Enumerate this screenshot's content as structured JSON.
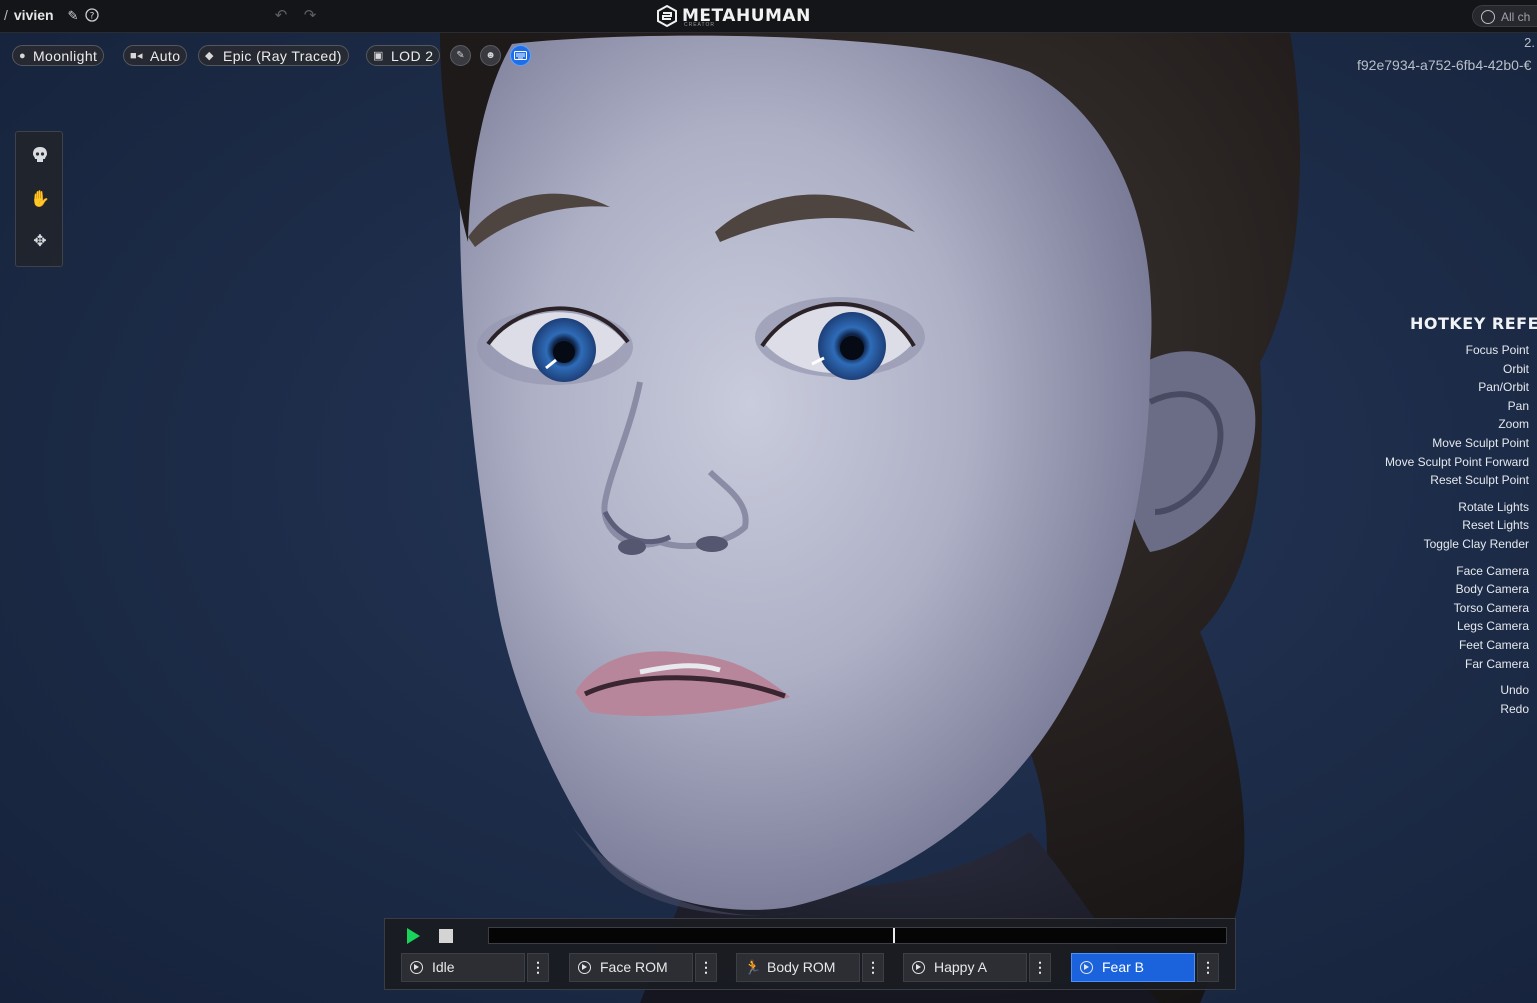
{
  "header": {
    "project_name": "vivien",
    "breadcrumb_separator": "/",
    "logo_text": "METAHUMAN",
    "logo_subtext": "CREATOR",
    "status_button": "All ch",
    "edit_icon": "pencil-icon",
    "help_icon": "help-icon",
    "undo_icon": "undo-icon",
    "redo_icon": "redo-icon"
  },
  "toolbar": {
    "lighting": "Moonlight",
    "camera": "Auto",
    "quality": "Epic (Ray Traced)",
    "lod": "LOD 2",
    "icons": [
      "brush-icon",
      "head-icon",
      "keyboard-icon"
    ]
  },
  "info": {
    "version": "2.",
    "guid": "f92e7934-a752-6fb4-42b0-€"
  },
  "tools": [
    "skull-icon",
    "hand-icon",
    "move-icon"
  ],
  "hotkeys": {
    "title": "HOTKEY REFE",
    "groups": [
      [
        "Focus Point",
        "Orbit",
        "Pan/Orbit",
        "Pan",
        "Zoom",
        "Move Sculpt Point",
        "Move Sculpt Point Forward",
        "Reset Sculpt Point"
      ],
      [
        "Rotate Lights",
        "Reset Lights",
        "Toggle Clay Render"
      ],
      [
        "Face Camera",
        "Body Camera",
        "Torso Camera",
        "Legs Camera",
        "Feet Camera",
        "Far Camera"
      ],
      [
        "Undo",
        "Redo"
      ]
    ]
  },
  "animation": {
    "playhead_fraction": 0.55,
    "clips": [
      {
        "label": "Idle",
        "icon": "play-circle-icon",
        "active": false
      },
      {
        "label": "Face ROM",
        "icon": "play-circle-icon",
        "active": false
      },
      {
        "label": "Body ROM",
        "icon": "running-icon",
        "active": false
      },
      {
        "label": "Happy A",
        "icon": "play-circle-icon",
        "active": false
      },
      {
        "label": "Fear B",
        "icon": "play-circle-icon",
        "active": true
      }
    ],
    "menu_glyph": "⋮"
  }
}
